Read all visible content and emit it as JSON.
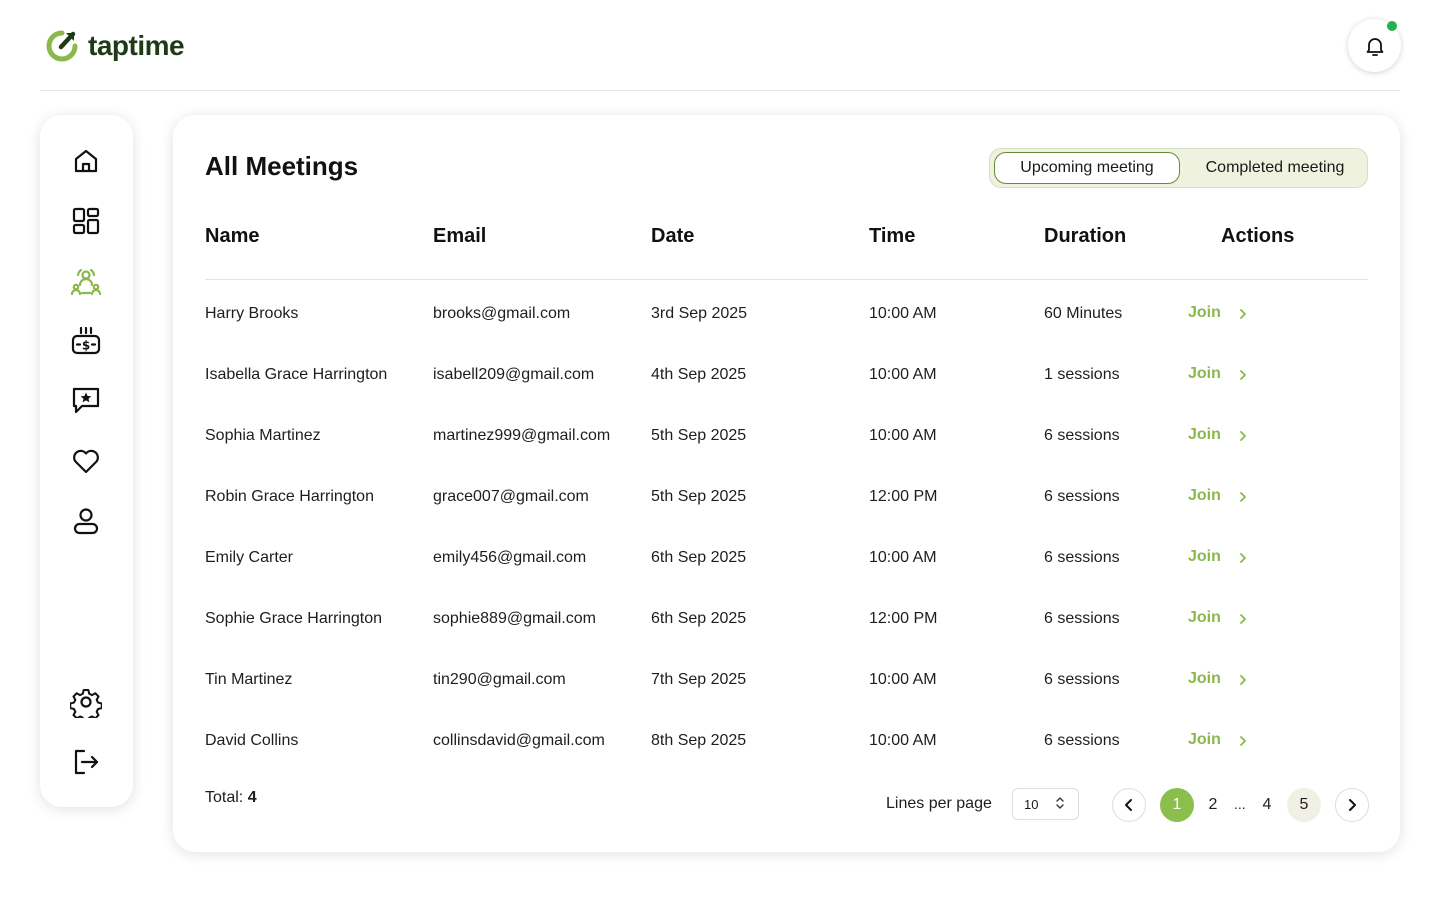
{
  "app": {
    "name": "taptime"
  },
  "colors": {
    "brand": "#8bb84a",
    "brand_dark": "#1f3a17",
    "notification": "#22b14c"
  },
  "sidebar": {
    "items": [
      {
        "icon": "home-icon"
      },
      {
        "icon": "dashboard-icon"
      },
      {
        "icon": "meetings-icon",
        "active": true
      },
      {
        "icon": "billing-icon"
      },
      {
        "icon": "reviews-icon"
      },
      {
        "icon": "favorites-icon"
      },
      {
        "icon": "profile-icon"
      },
      {
        "icon": "settings-icon"
      },
      {
        "icon": "logout-icon"
      }
    ]
  },
  "main": {
    "title": "All Meetings",
    "tabs": [
      {
        "label": "Upcoming meeting",
        "active": true
      },
      {
        "label": "Completed meeting",
        "active": false
      }
    ],
    "columns": [
      "Name",
      "Email",
      "Date",
      "Time",
      "Duration",
      "Actions"
    ],
    "rows": [
      {
        "name": "Harry Brooks",
        "email": "brooks@gmail.com",
        "date": "3rd Sep 2025",
        "time": "10:00 AM",
        "duration": "60 Minutes",
        "action": "Join"
      },
      {
        "name": "Isabella Grace Harrington",
        "email": "isabell209@gmail.com",
        "date": "4th Sep 2025",
        "time": "10:00 AM",
        "duration": "1 sessions",
        "action": "Join"
      },
      {
        "name": "Sophia Martinez",
        "email": "martinez999@gmail.com",
        "date": "5th Sep 2025",
        "time": "10:00 AM",
        "duration": "6 sessions",
        "action": "Join"
      },
      {
        "name": "Robin Grace Harrington",
        "email": "grace007@gmail.com",
        "date": "5th Sep 2025",
        "time": "12:00 PM",
        "duration": "6 sessions",
        "action": "Join"
      },
      {
        "name": "Emily Carter",
        "email": "emily456@gmail.com",
        "date": "6th Sep 2025",
        "time": "10:00 AM",
        "duration": "6 sessions",
        "action": "Join"
      },
      {
        "name": "Sophie Grace Harrington",
        "email": "sophie889@gmail.com",
        "date": "6th Sep 2025",
        "time": "12:00 PM",
        "duration": "6 sessions",
        "action": "Join"
      },
      {
        "name": "Tin Martinez",
        "email": "tin290@gmail.com",
        "date": "7th Sep 2025",
        "time": "10:00 AM",
        "duration": "6 sessions",
        "action": "Join"
      },
      {
        "name": "David Collins",
        "email": "collinsdavid@gmail.com",
        "date": "8th Sep 2025",
        "time": "10:00 AM",
        "duration": "6 sessions",
        "action": "Join"
      }
    ],
    "footer": {
      "total_label": "Total:",
      "total_value": "4",
      "lines_per_page_label": "Lines per page",
      "lines_per_page_value": "10",
      "pages": [
        "1",
        "2",
        "4",
        "5"
      ],
      "ellipsis": "...",
      "current_page": "1"
    }
  }
}
